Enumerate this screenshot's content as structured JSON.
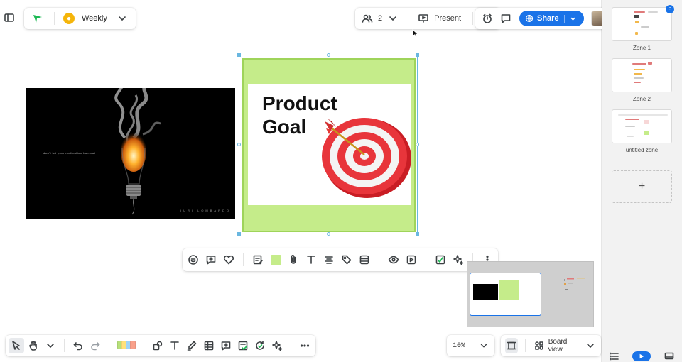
{
  "header": {
    "board_name": "Weekly",
    "collaborator_count": "2",
    "present_label": "Present",
    "share_label": "Share"
  },
  "canvas": {
    "bulb_image_caption": "don't let your motivation burnout",
    "bulb_image_signature": "IURI LOMBARDO",
    "product_goal_title_line1": "Product",
    "product_goal_title_line2": "Goal"
  },
  "bottom": {
    "zoom_level": "10%",
    "view_label": "Board view"
  },
  "zones": {
    "items": [
      {
        "label": "Zone 1"
      },
      {
        "label": "Zone 2"
      },
      {
        "label": "untitled zone"
      }
    ],
    "add_label": "+",
    "badge": "P"
  },
  "colors": {
    "accent": "#1a73e8",
    "product_card_fill": "#c5ec8a",
    "selection": "#6ab7e0"
  }
}
